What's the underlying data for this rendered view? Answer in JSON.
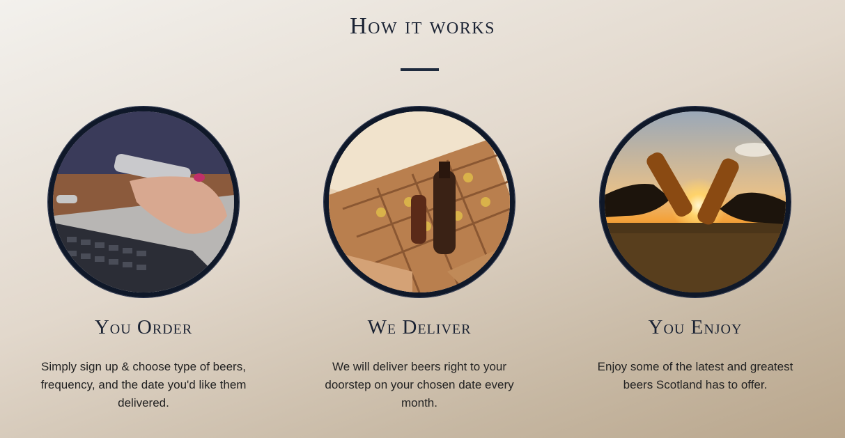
{
  "section": {
    "title": "How it works"
  },
  "steps": [
    {
      "title": "You Order",
      "description": "Simply sign up & choose type of beers, frequency, and the date you'd like them delivered.",
      "image_icon": "laptop-phone-photo"
    },
    {
      "title": "We Deliver",
      "description": "We will deliver beers right to your doorstep on your chosen date every month.",
      "image_icon": "beer-box-photo"
    },
    {
      "title": "You Enjoy",
      "description": "Enjoy some of the latest and greatest beers Scotland has to offer.",
      "image_icon": "beer-cheers-photo"
    }
  ],
  "colors": {
    "accent": "#1e2a3d",
    "circle_border": "#0f1829",
    "text": "#222222"
  }
}
